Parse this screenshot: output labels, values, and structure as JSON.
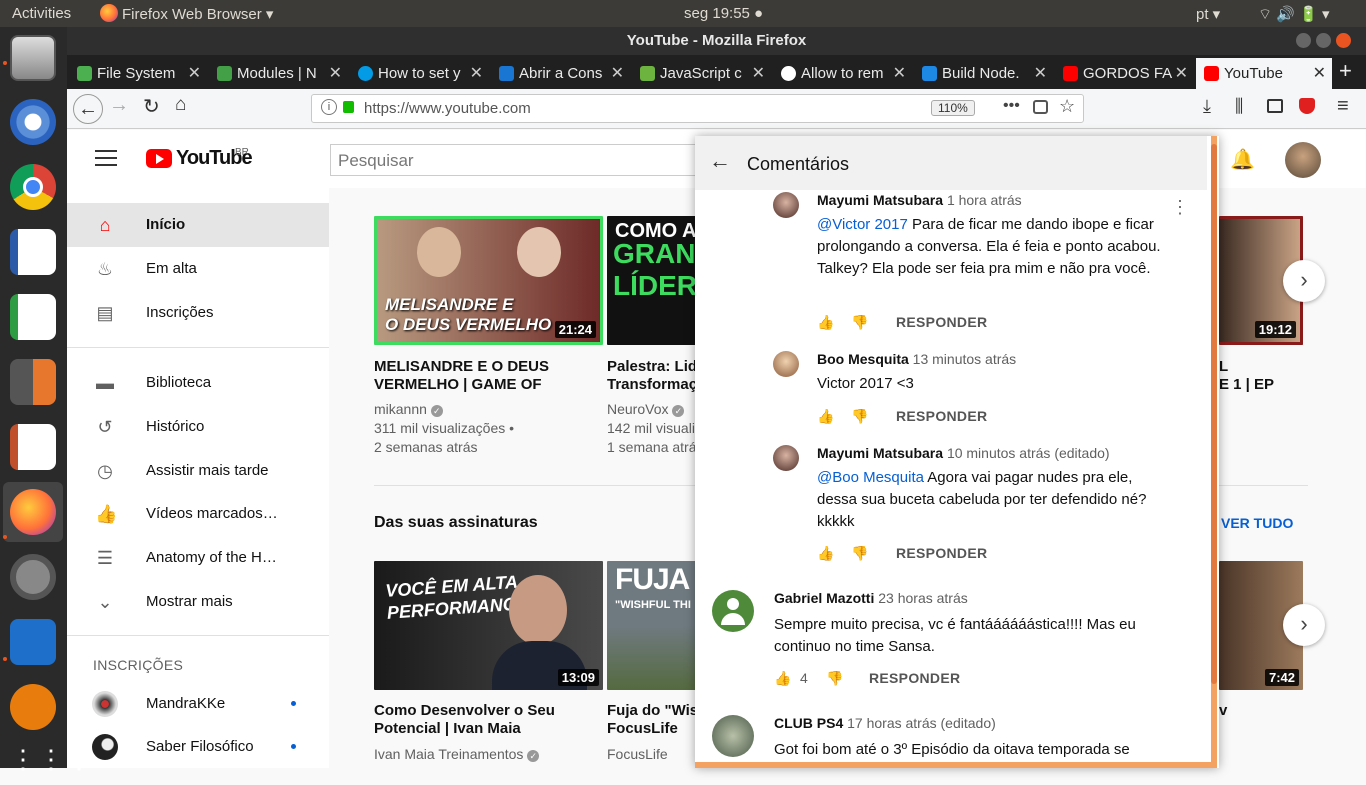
{
  "ubuntu": {
    "activities": "Activities",
    "app_menu": "Firefox Web Browser ▾",
    "clock": "seg 19:55 ●",
    "lang": "pt ▾",
    "tray": "⌔ 🔊 🔋 ▾"
  },
  "dock_items": [
    "files-icon",
    "chromium-icon",
    "chrome-icon",
    "writer-icon",
    "calc-icon",
    "calculator-icon",
    "impress-icon",
    "firefox-icon",
    "settings-icon",
    "vscode-icon",
    "blender-icon",
    "app-grid-icon"
  ],
  "window": {
    "title": "YouTube - Mozilla Firefox"
  },
  "tabs": [
    {
      "label": "File System",
      "color": "#4caf50"
    },
    {
      "label": "Modules | N",
      "color": "#43a047"
    },
    {
      "label": "How to set y",
      "color": "#039be5"
    },
    {
      "label": "Abrir a Cons",
      "color": "#1976d2"
    },
    {
      "label": "JavaScript c",
      "color": "#6db33f"
    },
    {
      "label": "Allow to rem",
      "color": "#ffffff"
    },
    {
      "label": "Build Node.",
      "color": "#1e88e5"
    },
    {
      "label": "GORDOS FA",
      "color": "#ff0000"
    },
    {
      "label": "YouTube",
      "color": "#ff0000"
    }
  ],
  "url": {
    "text": "https://www.youtube.com",
    "zoom": "110%"
  },
  "yt": {
    "logo_text": "YouTube",
    "region": "BR",
    "search_placeholder": "Pesquisar",
    "sidebar": [
      {
        "label": "Início",
        "icon": "home-icon",
        "active": true
      },
      {
        "label": "Em alta",
        "icon": "fire-icon"
      },
      {
        "label": "Inscrições",
        "icon": "subscriptions-icon"
      },
      {
        "label": "Biblioteca",
        "icon": "folder-icon"
      },
      {
        "label": "Histórico",
        "icon": "history-icon"
      },
      {
        "label": "Assistir mais tarde",
        "icon": "clock-icon"
      },
      {
        "label": "Vídeos marcados…",
        "icon": "thumbs-up-icon"
      },
      {
        "label": "Anatomy of the H…",
        "icon": "playlist-icon"
      },
      {
        "label": "Mostrar mais",
        "icon": "chevron-down-icon"
      }
    ],
    "subs_header": "INSCRIÇÕES",
    "subs": [
      {
        "label": "MandraKKe"
      },
      {
        "label": "Saber Filosófico"
      }
    ],
    "videos_row1": [
      {
        "title1": "MELISANDRE E O DEUS",
        "title2": "VERMELHO | GAME OF",
        "channel": "mikannn",
        "views": "311 mil visualizações •",
        "age": "2 semanas atrás",
        "duration": "21:24",
        "thumb_text1": "MELISANDRE E",
        "thumb_text2": "O DEUS VERMELHO"
      },
      {
        "title1": "Palestra: Lide",
        "title2": "Transformaçã",
        "channel": "NeuroVox",
        "views": "142 mil visuali",
        "age": "1 semana atrá",
        "thumb_text1": "COMO A",
        "thumb_text2": "GRAN",
        "thumb_text3": "LÍDERE"
      }
    ],
    "row1_partial": {
      "title1": "L",
      "title2": "E 1 | EP",
      "duration": "19:12"
    },
    "section_title": "Das suas assinaturas",
    "see_all": "VER TUDO",
    "videos_row2": [
      {
        "title1": "Como Desenvolver o Seu",
        "title2": "Potencial | Ivan Maia",
        "channel": "Ivan Maia Treinamentos",
        "duration": "13:09",
        "thumb_text1": "VOCÊ EM ALTA",
        "thumb_text2": "PERFORMANCE"
      },
      {
        "title1": "Fuja do \"Wish",
        "title2": "FocusLife",
        "channel": "FocusLife",
        "thumb_text1": "FUJA D",
        "thumb_text2": "\"WISHFUL THI"
      }
    ],
    "row2_partial": {
      "title1": "v",
      "duration": "7:42"
    }
  },
  "comments": {
    "header": "Comentários",
    "reply_label": "RESPONDER",
    "items": [
      {
        "author": "Mayumi Matsubara",
        "time": "1 hora atrás",
        "mention": "@Victor 2017",
        "text": " Para de ficar me dando ibope e ficar prolongando a conversa. Ela é feia e ponto acabou. Talkey? Ela pode ser feia pra mim e não pra você.",
        "likes": ""
      },
      {
        "author": "Boo Mesquita",
        "time": "13 minutos atrás",
        "mention": "",
        "text": "Victor 2017 <3",
        "likes": ""
      },
      {
        "author": "Mayumi Matsubara",
        "time": "10 minutos atrás (editado)",
        "mention": "@Boo Mesquita",
        "text": " Agora vai pagar nudes pra ele, dessa sua buceta cabeluda por ter defendido né? kkkkk",
        "likes": ""
      },
      {
        "author": "Gabriel Mazotti",
        "time": "23 horas atrás",
        "mention": "",
        "text": "Sempre muito precisa, vc é fantáááááástica!!!! Mas eu continuo no time Sansa.",
        "likes": "4"
      },
      {
        "author": "CLUB PS4",
        "time": "17 horas atrás (editado)",
        "mention": "",
        "text": "Got foi bom até o 3º Episódio da oitava temporada se",
        "likes": ""
      }
    ]
  }
}
